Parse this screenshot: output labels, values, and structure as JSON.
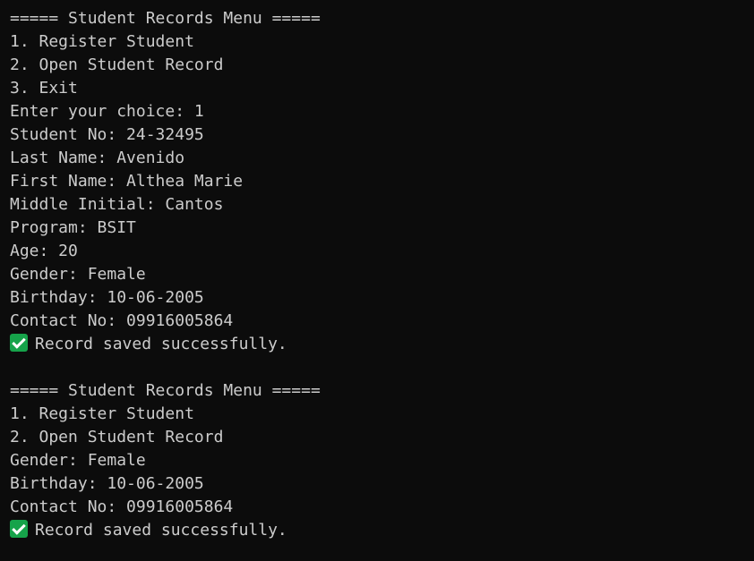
{
  "menu1": {
    "title": "===== Student Records Menu =====",
    "options": [
      "1. Register Student",
      "2. Open Student Record",
      "3. Exit"
    ],
    "prompt": "Enter your choice: 1"
  },
  "record": {
    "student_no": "Student No: 24-32495",
    "last_name": "Last Name: Avenido",
    "first_name": "First Name: Althea Marie",
    "middle_initial": "Middle Initial: Cantos",
    "program": "Program: BSIT",
    "age": "Age: 20",
    "gender": "Gender: Female",
    "birthday": "Birthday: 10-06-2005",
    "contact": "Contact No: 09916005864"
  },
  "status1": {
    "icon": "check-mark-icon",
    "text": "Record saved successfully."
  },
  "menu2": {
    "title": "===== Student Records Menu =====",
    "options": [
      "1. Register Student",
      "2. Open Student Record"
    ]
  },
  "record2": {
    "gender": "Gender: Female",
    "birthday": "Birthday: 10-06-2005",
    "contact": "Contact No: 09916005864"
  },
  "status2": {
    "icon": "check-mark-icon",
    "text": "Record saved successfully."
  },
  "colors": {
    "background": "#0c0c0c",
    "foreground": "#cccccc",
    "check_green": "#16a34a"
  }
}
